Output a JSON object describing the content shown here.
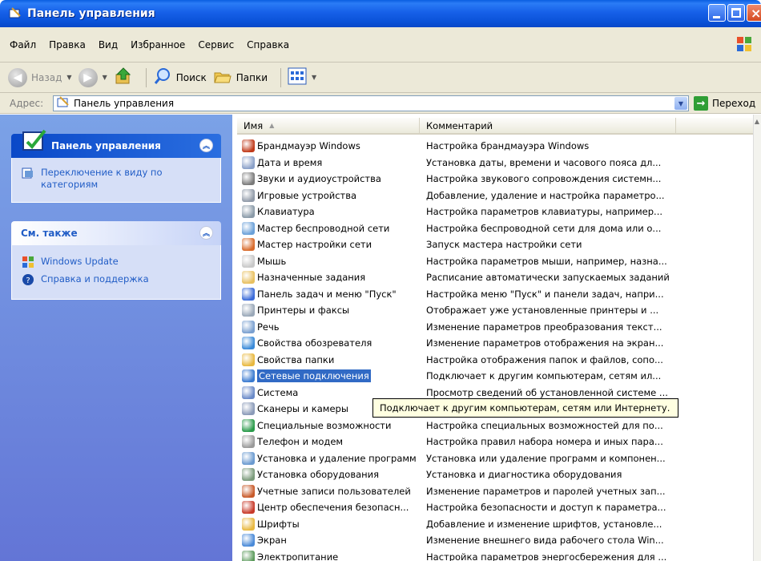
{
  "window": {
    "title": "Панель управления",
    "min_icon": "minimize-icon",
    "max_icon": "maximize-icon",
    "close_icon": "close-icon"
  },
  "menu": [
    "Файл",
    "Правка",
    "Вид",
    "Избранное",
    "Сервис",
    "Справка"
  ],
  "toolbar": {
    "back": "Назад",
    "search": "Поиск",
    "folders": "Папки"
  },
  "address": {
    "label": "Адрес:",
    "value": "Панель управления",
    "go": "Переход"
  },
  "sidebar": {
    "panel1": {
      "title": "Панель управления",
      "tasks": [
        "Переключение к виду по категориям"
      ]
    },
    "panel2": {
      "title": "См. также",
      "tasks": [
        "Windows Update",
        "Справка и поддержка"
      ]
    }
  },
  "list": {
    "headers": {
      "name": "Имя",
      "comment": "Комментарий"
    },
    "rows": [
      {
        "name": "Брандмауэр Windows",
        "comment": "Настройка брандмауэра Windows",
        "color": "#c03a1a"
      },
      {
        "name": "Дата и время",
        "comment": "Установка даты, времени и часового пояса дл...",
        "color": "#8aa0c8"
      },
      {
        "name": "Звуки и аудиоустройства",
        "comment": "Настройка звукового сопровождения системн...",
        "color": "#7a7a7a"
      },
      {
        "name": "Игровые устройства",
        "comment": "Добавление, удаление и настройка параметро...",
        "color": "#909aa8"
      },
      {
        "name": "Клавиатура",
        "comment": "Настройка параметров клавиатуры, например...",
        "color": "#8a9aa8"
      },
      {
        "name": "Мастер беспроводной сети",
        "comment": "Настройка беспроводной сети для дома или о...",
        "color": "#6aa0d8"
      },
      {
        "name": "Мастер настройки сети",
        "comment": "Запуск мастера настройки сети",
        "color": "#d86a2a"
      },
      {
        "name": "Мышь",
        "comment": "Настройка параметров мыши, например, назна...",
        "color": "#c8c8c8"
      },
      {
        "name": "Назначенные задания",
        "comment": "Расписание автоматически запускаемых заданий",
        "color": "#e8c060"
      },
      {
        "name": "Панель задач и меню \"Пуск\"",
        "comment": "Настройка меню \"Пуск\" и панели задач, напри...",
        "color": "#3a6ad8"
      },
      {
        "name": "Принтеры и факсы",
        "comment": "Отображает уже установленные принтеры и ...",
        "color": "#9aa8b8"
      },
      {
        "name": "Речь",
        "comment": "Изменение параметров преобразования текст...",
        "color": "#7aa0d0"
      },
      {
        "name": "Свойства обозревателя",
        "comment": "Изменение параметров отображения на экран...",
        "color": "#3a8ad8"
      },
      {
        "name": "Свойства папки",
        "comment": "Настройка отображения папок и файлов, сопо...",
        "color": "#e8b840"
      },
      {
        "name": "Сетевые подключения",
        "comment": "Подключает к другим компьютерам, сетям ил...",
        "color": "#3a7ad0",
        "selected": true
      },
      {
        "name": "Система",
        "comment": "Просмотр сведений об установленной системе ...",
        "color": "#6a8ac8"
      },
      {
        "name": "Сканеры и камеры",
        "comment": "",
        "color": "#8a9ab8"
      },
      {
        "name": "Специальные возможности",
        "comment": "Настройка специальных возможностей для по...",
        "color": "#2a9a4a"
      },
      {
        "name": "Телефон и модем",
        "comment": "Настройка правил набора номера и иных пара...",
        "color": "#9a9a9a"
      },
      {
        "name": "Установка и удаление программ",
        "comment": "Установка или удаление программ и компонен...",
        "color": "#6a9ad0"
      },
      {
        "name": "Установка оборудования",
        "comment": "Установка и диагностика оборудования",
        "color": "#7a9a7a"
      },
      {
        "name": "Учетные записи пользователей",
        "comment": "Изменение параметров и паролей учетных зап...",
        "color": "#c85a2a"
      },
      {
        "name": "Центр обеспечения безопасн...",
        "comment": "Настройка безопасности и доступ к параметра...",
        "color": "#c83a2a"
      },
      {
        "name": "Шрифты",
        "comment": "Добавление и изменение шрифтов, установле...",
        "color": "#e8b840"
      },
      {
        "name": "Экран",
        "comment": "Изменение внешнего вида рабочего стола Win...",
        "color": "#4a8ad8"
      },
      {
        "name": "Электропитание",
        "comment": "Настройка параметров энергосбережения для ...",
        "color": "#5a9a5a"
      }
    ]
  },
  "tooltip": "Подключает к другим компьютерам, сетям или Интернету."
}
